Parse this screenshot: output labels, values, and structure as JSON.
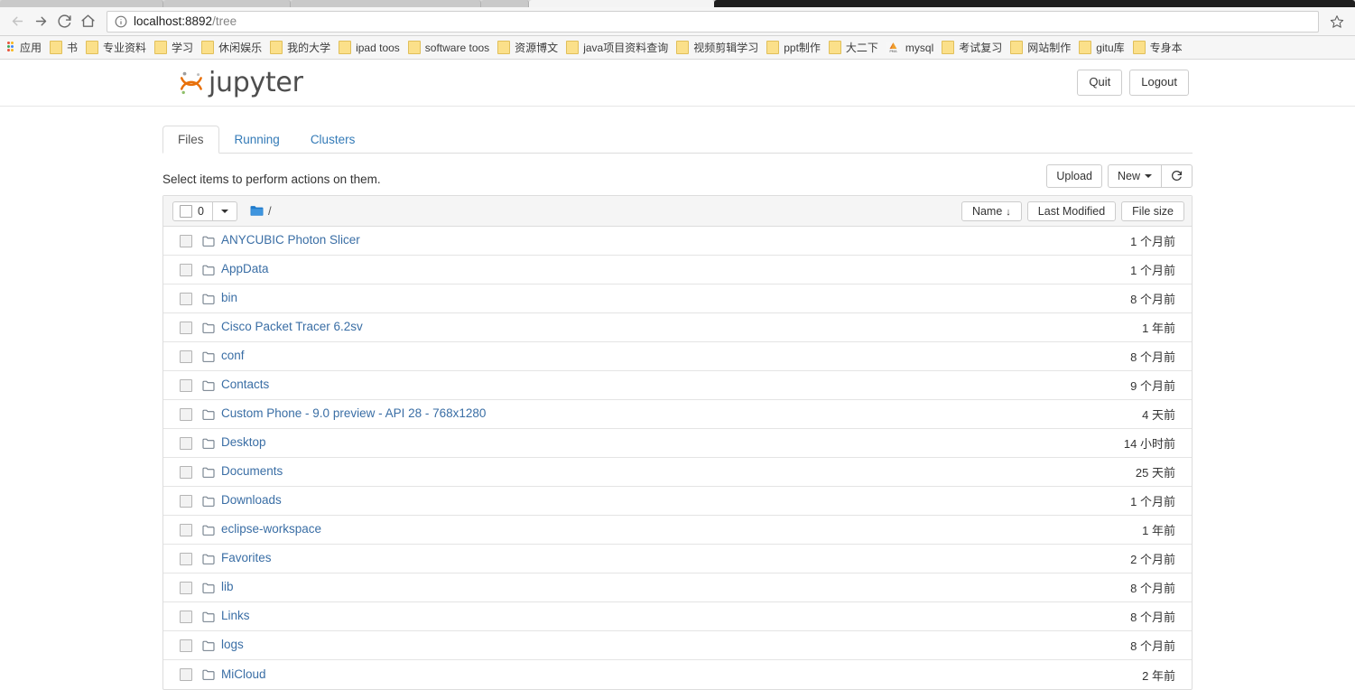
{
  "browser": {
    "url_host": "localhost:8892",
    "url_path": "/tree",
    "back_label": "Back",
    "forward_label": "Forward",
    "reload_label": "Reload",
    "home_label": "Home",
    "bookmark_star_label": "Bookmark this page",
    "bookmarks": [
      {
        "label": "应用",
        "icon": "apps-grid-icon"
      },
      {
        "label": "书",
        "icon": "folder-icon"
      },
      {
        "label": "专业资料",
        "icon": "folder-icon"
      },
      {
        "label": "学习",
        "icon": "folder-icon"
      },
      {
        "label": "休闲娱乐",
        "icon": "folder-icon"
      },
      {
        "label": "我的大学",
        "icon": "folder-icon"
      },
      {
        "label": "ipad  toos",
        "icon": "folder-icon"
      },
      {
        "label": "software toos",
        "icon": "folder-icon"
      },
      {
        "label": "资源博文",
        "icon": "folder-icon"
      },
      {
        "label": "java项目资料查询",
        "icon": "folder-icon"
      },
      {
        "label": "视频剪辑学习",
        "icon": "folder-icon"
      },
      {
        "label": "ppt制作",
        "icon": "folder-icon"
      },
      {
        "label": "大二下",
        "icon": "folder-icon"
      },
      {
        "label": "mysql",
        "icon": "phpmyadmin-icon"
      },
      {
        "label": "考试复习",
        "icon": "folder-icon"
      },
      {
        "label": "网站制作",
        "icon": "folder-icon"
      },
      {
        "label": "gitu库",
        "icon": "folder-icon"
      },
      {
        "label": "专身本",
        "icon": "folder-icon"
      }
    ]
  },
  "header": {
    "logo_text": "jupyter",
    "quit_label": "Quit",
    "logout_label": "Logout"
  },
  "tabs": [
    {
      "label": "Files",
      "active": true
    },
    {
      "label": "Running",
      "active": false
    },
    {
      "label": "Clusters",
      "active": false
    }
  ],
  "toolbar": {
    "hint": "Select items to perform actions on them.",
    "upload_label": "Upload",
    "new_label": "New",
    "refresh_label": "Refresh"
  },
  "list_toolbar": {
    "selected_count": "0",
    "breadcrumb_path": "/",
    "sort_name_label": "Name",
    "sort_name_arrow": "↓",
    "sort_modified_label": "Last Modified",
    "sort_size_label": "File size"
  },
  "colors": {
    "link": "#3a6ea5",
    "tab_link": "#337ab7",
    "jupyter_orange": "#e8700a",
    "folder_blue": "#1e7acb"
  },
  "files": [
    {
      "name": "ANYCUBIC Photon Slicer",
      "modified": "1 个月前",
      "type": "folder"
    },
    {
      "name": "AppData",
      "modified": "1 个月前",
      "type": "folder"
    },
    {
      "name": "bin",
      "modified": "8 个月前",
      "type": "folder"
    },
    {
      "name": "Cisco Packet Tracer 6.2sv",
      "modified": "1 年前",
      "type": "folder"
    },
    {
      "name": "conf",
      "modified": "8 个月前",
      "type": "folder"
    },
    {
      "name": "Contacts",
      "modified": "9 个月前",
      "type": "folder"
    },
    {
      "name": "Custom Phone - 9.0 preview - API 28 - 768x1280",
      "modified": "4 天前",
      "type": "folder"
    },
    {
      "name": "Desktop",
      "modified": "14 小时前",
      "type": "folder"
    },
    {
      "name": "Documents",
      "modified": "25 天前",
      "type": "folder"
    },
    {
      "name": "Downloads",
      "modified": "1 个月前",
      "type": "folder"
    },
    {
      "name": "eclipse-workspace",
      "modified": "1 年前",
      "type": "folder"
    },
    {
      "name": "Favorites",
      "modified": "2 个月前",
      "type": "folder"
    },
    {
      "name": "lib",
      "modified": "8 个月前",
      "type": "folder"
    },
    {
      "name": "Links",
      "modified": "8 个月前",
      "type": "folder"
    },
    {
      "name": "logs",
      "modified": "8 个月前",
      "type": "folder"
    },
    {
      "name": "MiCloud",
      "modified": "2 年前",
      "type": "folder"
    }
  ]
}
